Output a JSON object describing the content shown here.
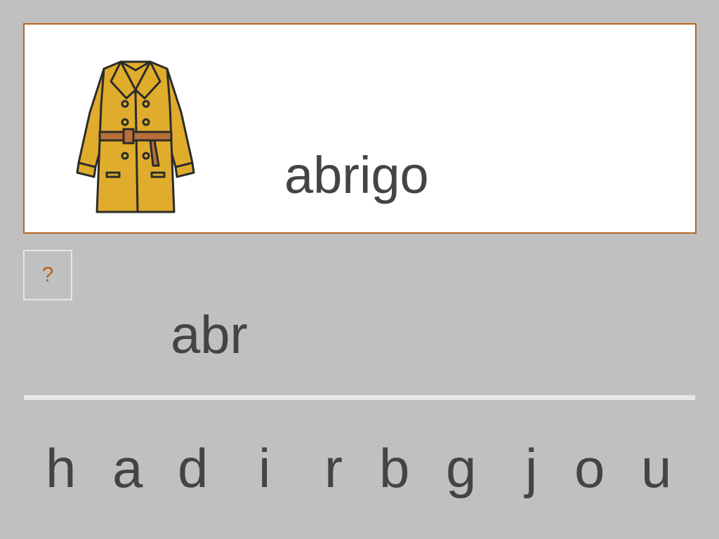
{
  "exercise": {
    "target_word": "abrigo",
    "typed_word": "abr",
    "hint_label": "?"
  },
  "picture": {
    "icon": "coat-icon",
    "coat_color": "#e0ac2b",
    "belt_color": "#b8703a"
  },
  "letters": [
    "h",
    "a",
    "d",
    "i",
    "r",
    "b",
    "g",
    "j",
    "o",
    "u"
  ],
  "colors": {
    "background": "#c0c0c0",
    "card_border": "#b5651d",
    "text": "#444444",
    "hint": "#b5651d"
  }
}
